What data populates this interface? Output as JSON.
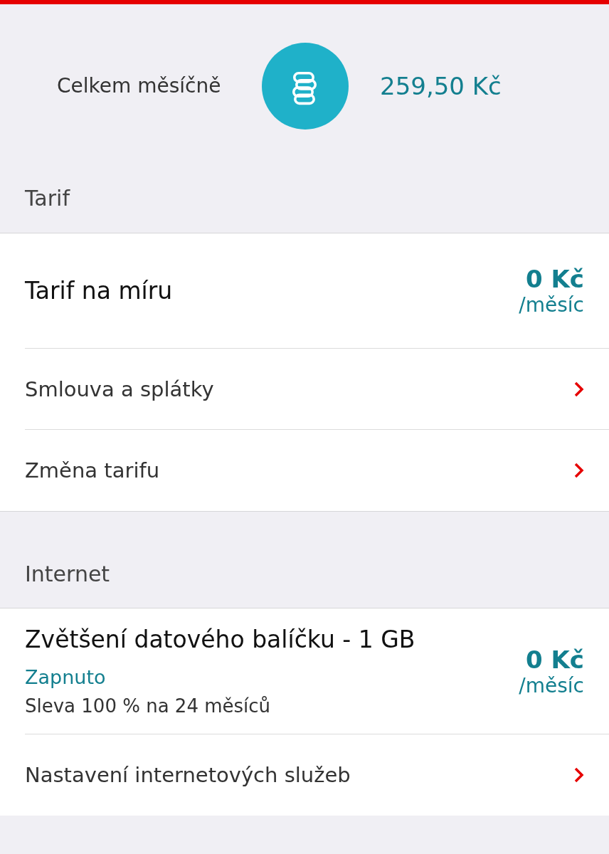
{
  "summary": {
    "label": "Celkem měsíčně",
    "amount": "259,50 Kč"
  },
  "sections": [
    {
      "header": "Tarif",
      "rows": [
        {
          "kind": "price",
          "title": "Tarif na míru",
          "price": "0 Kč",
          "period": "/měsíc"
        },
        {
          "kind": "link",
          "title": "Smlouva a splátky"
        },
        {
          "kind": "link",
          "title": "Změna tarifu"
        }
      ]
    },
    {
      "header": "Internet",
      "rows": [
        {
          "kind": "price",
          "title": "Zvětšení datového balíčku - 1 GB",
          "status": "Zapnuto",
          "note": "Sleva 100 % na 24 měsíců",
          "price": "0 Kč",
          "period": "/měsíc"
        },
        {
          "kind": "link",
          "title": "Nastavení internetových služeb"
        }
      ]
    }
  ]
}
